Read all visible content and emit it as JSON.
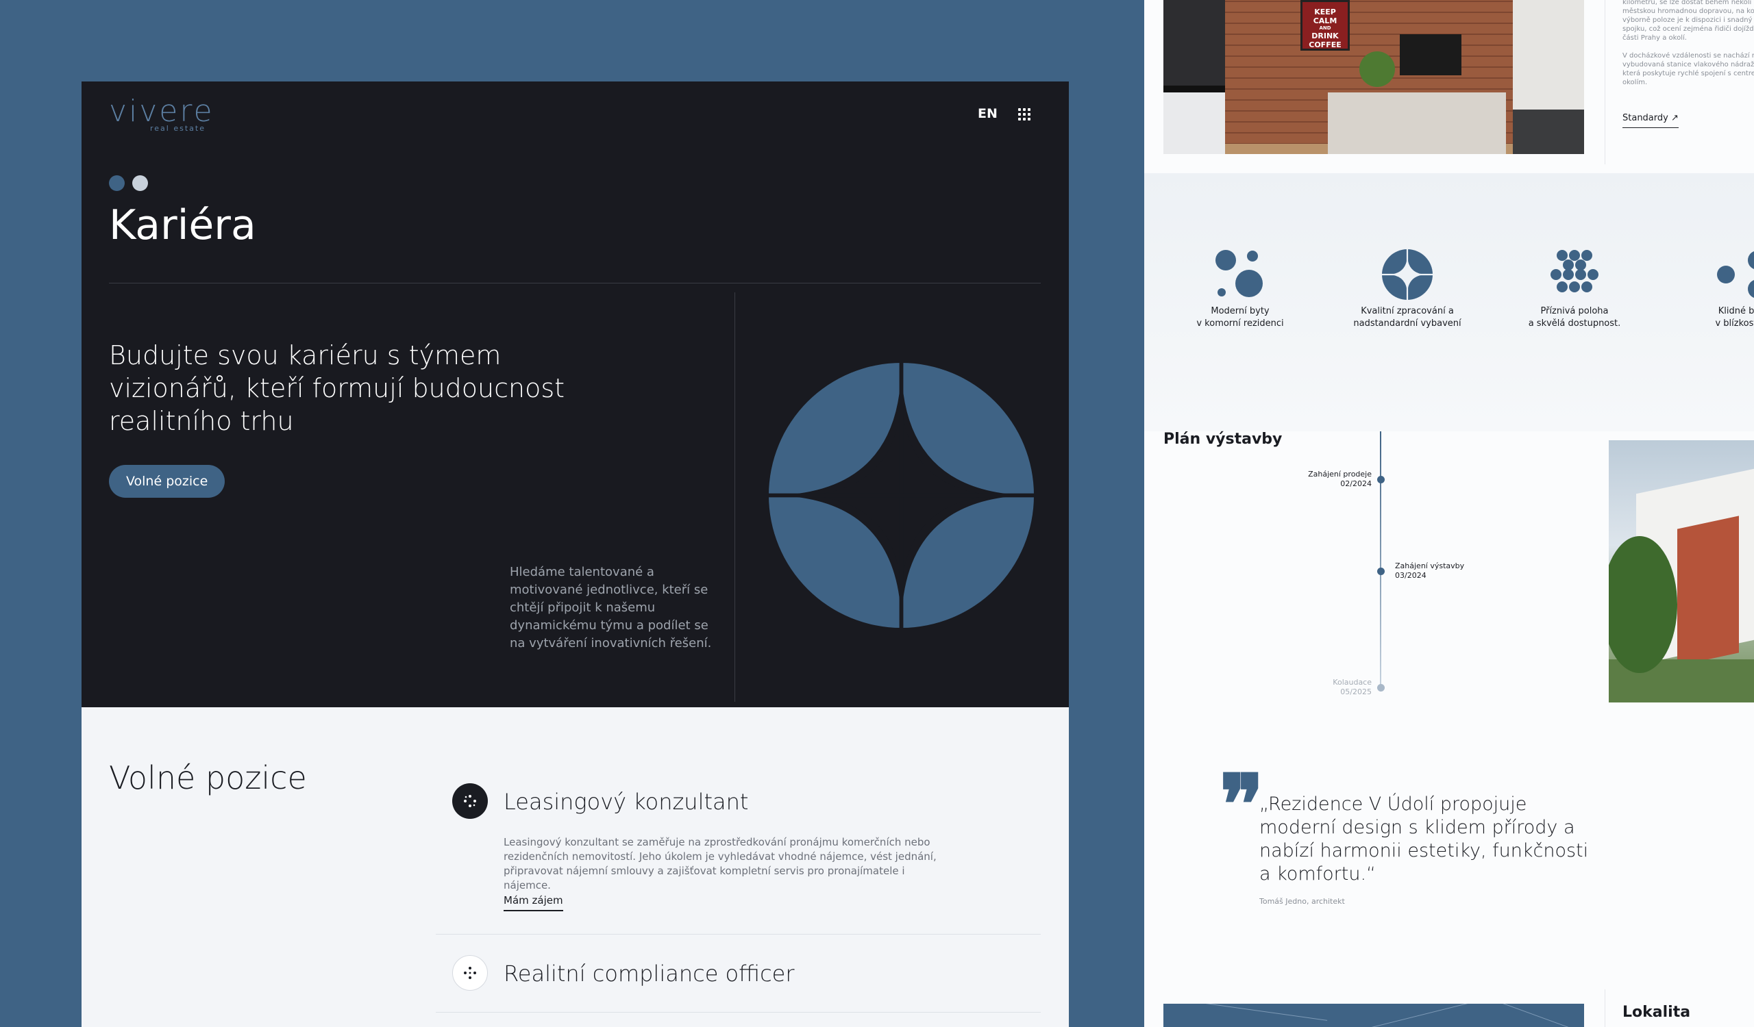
{
  "brand": {
    "name": "vivere",
    "tagline": "real estate"
  },
  "header": {
    "lang": "EN"
  },
  "hero": {
    "title": "Kariéra",
    "headline": "Budujte svou kariéru s týmem vizionářů, kteří formují budoucnost realitního trhu",
    "cta": "Volné pozice",
    "text": "Hledáme talentované a motivované jednotlivce, kteří se chtějí připojit k našemu dynamickému týmu a podílet se na vytváření inovativních řešení."
  },
  "jobs": {
    "title": "Volné pozice",
    "items": [
      {
        "title": "Leasingový konzultant",
        "description": "Leasingový konzultant se zaměřuje na zprostředkování pronájmu komerčních nebo rezidenčních nemovitostí. Jeho úkolem je vyhledávat vhodné nájemce, vést jednání, připravovat nájemní smlouvy a zajišťovat kompletní servis pro pronajímatele i nájemce.",
        "link": "Mám zájem"
      },
      {
        "title": "Realitní compliance officer"
      }
    ]
  },
  "right": {
    "photo_sign": [
      "KEEP",
      "CALM",
      "AND",
      "DRINK",
      "COFFEE"
    ],
    "text_lines_1": [
      "kilometrů, se lze dostat během několi",
      "městskou hromadnou dopravou, na kol",
      "výborně poloze je k dispozici i snadný",
      "spojku, což ocení zejména řidiči dojížd",
      "části Prahy a okolí."
    ],
    "text_lines_2": [
      "V docházkové vzdálenosti se nachází n",
      "vybudovaná stanice vlakového nádraží",
      "která poskytuje rychlé spojení s centrer",
      "okolím."
    ],
    "standards_link": "Standardy ↗",
    "features": [
      {
        "line1": "Moderní byty",
        "line2": "v komorní rezidenci",
        "icon": "dots-cluster-icon"
      },
      {
        "line1": "Kvalitní zpracování a",
        "line2": "nadstandardní vybavení",
        "icon": "star-circle-icon"
      },
      {
        "line1": "Příznivá poloha",
        "line2": "a skvělá dostupnost.",
        "icon": "dot-grid-icon"
      },
      {
        "line1": "Klidné byd",
        "line2": "v blízkosti p",
        "icon": "circles-icon"
      }
    ],
    "plan": {
      "title": "Plán výstavby",
      "milestones": [
        {
          "line1": "Zahájení prodeje",
          "line2": "02/2024"
        },
        {
          "line1": "Zahájení výstavby",
          "line2": "03/2024"
        },
        {
          "line1": "Kolaudace",
          "line2": "05/2025"
        }
      ]
    },
    "quote": {
      "mark": "❞",
      "text": "„Rezidence V Údolí propojuje moderní design s klidem přírody a nabízí harmonii estetiky, funkčnosti a komfortu.“",
      "author": "Tomáš Jedno, architekt"
    },
    "location_title": "Lokalita"
  },
  "colors": {
    "accent": "#3f6385",
    "dark": "#191a20",
    "light": "#f3f5f8"
  }
}
